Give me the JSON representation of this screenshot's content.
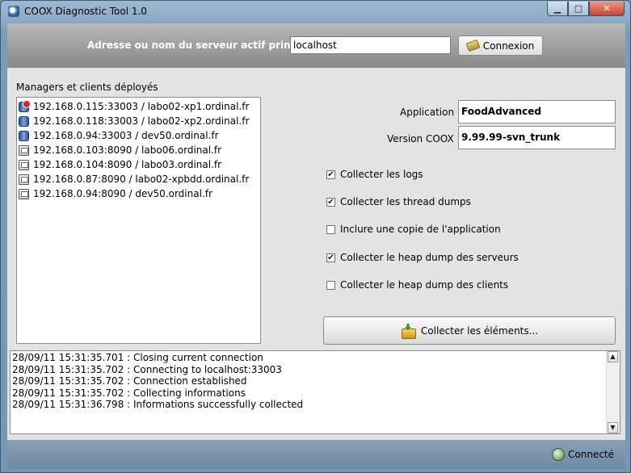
{
  "window": {
    "title": "COOX Diagnostic Tool 1.0",
    "minimize_icon": "minimize-icon",
    "maximize_icon": "maximize-icon",
    "close_icon": "close-icon"
  },
  "server": {
    "label": "Adresse ou nom du serveur actif principal",
    "value": "localhost",
    "connect_label": "Connexion"
  },
  "managers": {
    "label": "Managers et clients déployés",
    "items": [
      {
        "text": "192.168.0.115:33003 / labo02-xp1.ordinal.fr",
        "icon": "database-error-icon"
      },
      {
        "text": "192.168.0.118:33003 / labo02-xp2.ordinal.fr",
        "icon": "database-icon"
      },
      {
        "text": "192.168.0.94:33003 / dev50.ordinal.fr",
        "icon": "database-icon"
      },
      {
        "text": "192.168.0.103:8090 / labo06.ordinal.fr",
        "icon": "computer-icon"
      },
      {
        "text": "192.168.0.104:8090 / labo03.ordinal.fr",
        "icon": "computer-icon"
      },
      {
        "text": "192.168.0.87:8090 / labo02-xpbdd.ordinal.fr",
        "icon": "computer-icon"
      },
      {
        "text": "192.168.0.94:8090 / dev50.ordinal.fr",
        "icon": "computer-icon"
      }
    ]
  },
  "application": {
    "label": "Application",
    "value": "FoodAdvanced"
  },
  "version": {
    "label": "Version COOX",
    "value": "9.99.99-svn_trunk"
  },
  "options": [
    {
      "label": "Collecter les logs",
      "checked": true
    },
    {
      "label": "Collecter les thread dumps",
      "checked": true
    },
    {
      "label": "Inclure une copie de l'application",
      "checked": false
    },
    {
      "label": "Collecter le heap dump des serveurs",
      "checked": true
    },
    {
      "label": "Collecter le heap dump des clients",
      "checked": false
    }
  ],
  "collect_button": {
    "label": "Collecter les éléments..."
  },
  "log": [
    "28/09/11 15:31:35.701 : Closing current connection",
    "28/09/11 15:31:35.702 : Connecting to localhost:33003",
    "28/09/11 15:31:35.702 : Connection established",
    "28/09/11 15:31:35.702 : Collecting informations",
    "28/09/11 15:31:36.798 : Informations successfully collected"
  ],
  "status": {
    "text": "Connecté"
  },
  "colors": {
    "server_bar": "#9a9a9a",
    "client_bg": "#e3e3e3",
    "frame": "#7897b3"
  }
}
